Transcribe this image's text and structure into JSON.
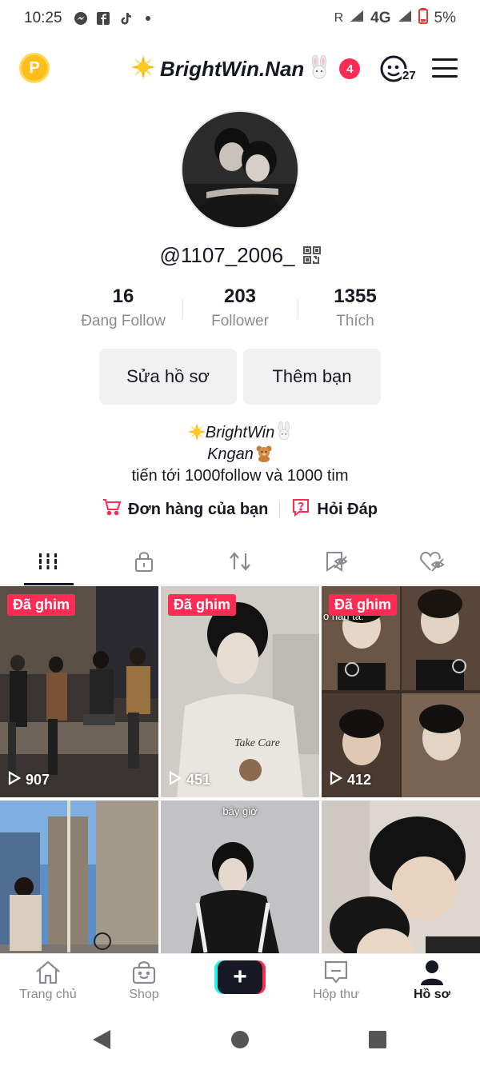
{
  "status_bar": {
    "time": "10:25",
    "network": "R",
    "signal": "4G",
    "battery": "5%",
    "icons": [
      "messenger-icon",
      "facebook-icon",
      "tiktok-icon",
      "dot-icon",
      "signal-icon",
      "battery-low-icon"
    ]
  },
  "header": {
    "title": "BrightWin.Nan",
    "notification_count": "4",
    "friends_count": "27",
    "title_emoji": "sun-emoji",
    "title_suffix_emoji": "rabbit-emoji"
  },
  "profile": {
    "username": "@1107_2006_",
    "stats": [
      {
        "value": "16",
        "label": "Đang Follow"
      },
      {
        "value": "203",
        "label": "Follower"
      },
      {
        "value": "1355",
        "label": "Thích"
      }
    ],
    "edit_button": "Sửa hồ sơ",
    "add_friend_button": "Thêm bạn",
    "bio": {
      "line1": "BrightWin",
      "line2": "Kngan",
      "line3": "tiến tới 1000follow và 1000 tim"
    },
    "links": {
      "orders": "Đơn hàng của bạn",
      "qa": "Hỏi Đáp"
    }
  },
  "tabs": [
    "videos-grid-icon",
    "private-lock-icon",
    "repost-icon",
    "saved-icon",
    "liked-icon"
  ],
  "videos": [
    {
      "pinned_label": "Đã ghim",
      "views": "907",
      "overlay_text": ""
    },
    {
      "pinned_label": "Đã ghim",
      "views": "451",
      "overlay_text": ""
    },
    {
      "pinned_label": "Đã ghim",
      "views": "412",
      "overlay_text": "o han ta:"
    },
    {
      "pinned_label": "",
      "views": "",
      "overlay_text": ""
    },
    {
      "pinned_label": "",
      "views": "",
      "overlay_text": "bây giờ"
    },
    {
      "pinned_label": "",
      "views": "",
      "overlay_text": ""
    }
  ],
  "bottom_nav": [
    {
      "label": "Trang chủ",
      "icon": "home-icon"
    },
    {
      "label": "Shop",
      "icon": "shop-icon"
    },
    {
      "label": "",
      "icon": "create-plus-icon"
    },
    {
      "label": "Hộp thư",
      "icon": "inbox-icon"
    },
    {
      "label": "Hồ sơ",
      "icon": "profile-icon"
    }
  ],
  "colors": {
    "accent": "#fe2c55",
    "cyan": "#25f4ee",
    "text_primary": "#161823",
    "text_secondary": "#8a8b91",
    "button_bg": "#f1f1f2",
    "coin": "#ffbe1a"
  }
}
